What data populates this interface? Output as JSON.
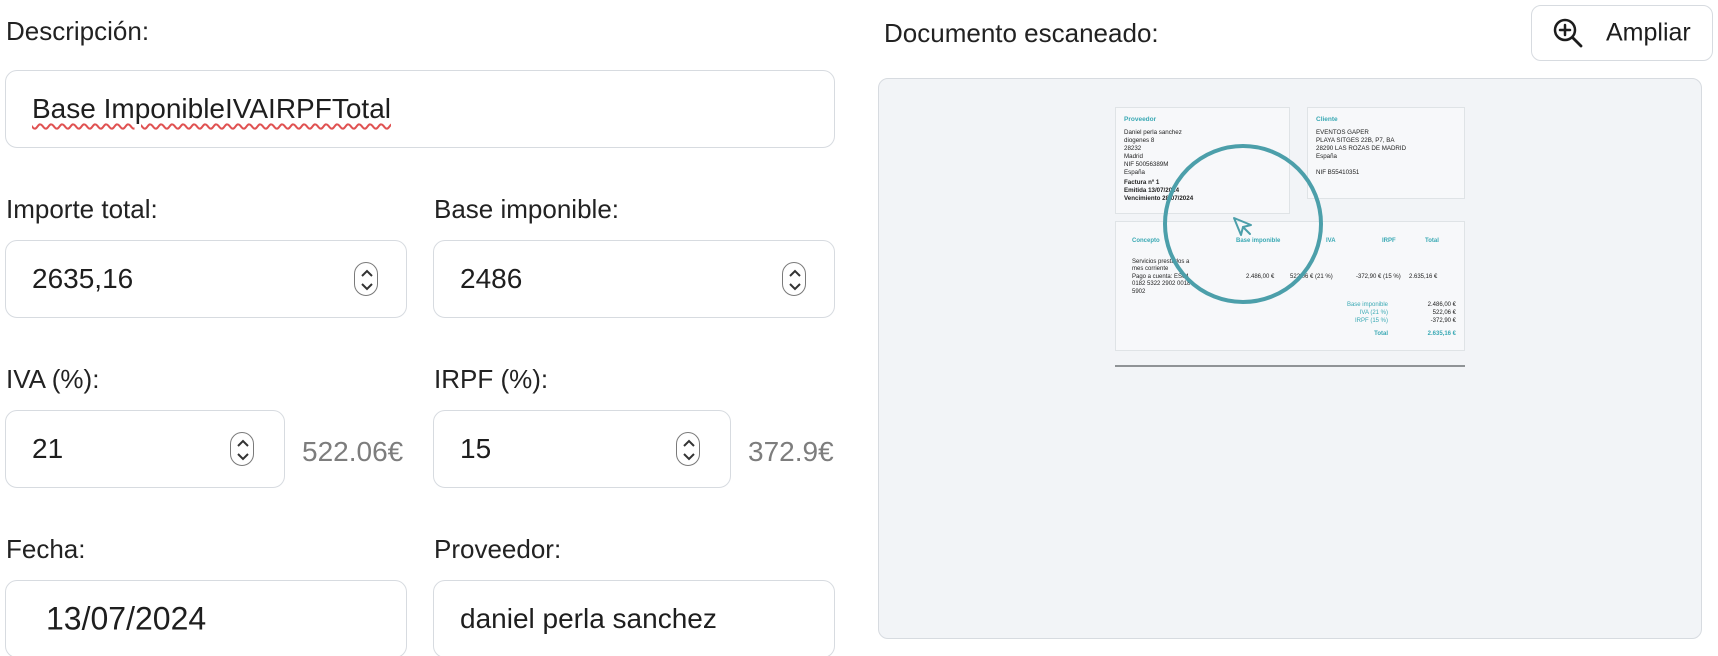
{
  "form": {
    "descripcion": {
      "label": "Descripción:",
      "value": "Base ImponibleIVAIRPFTotal"
    },
    "importe_total": {
      "label": "Importe total:",
      "value": "2635,16"
    },
    "base_imponible": {
      "label": "Base imponible:",
      "value": "2486"
    },
    "iva": {
      "label": "IVA (%):",
      "value": "21",
      "amount": "522.06€"
    },
    "irpf": {
      "label": "IRPF (%):",
      "value": "15",
      "amount": "372.9€"
    },
    "fecha": {
      "label": "Fecha:",
      "value": "13/07/2024"
    },
    "proveedor": {
      "label": "Proveedor:",
      "value": "daniel perla sanchez"
    }
  },
  "scan": {
    "title": "Documento escaneado:",
    "zoom_button": "Ampliar",
    "zoom_icon": "zoom-in-icon",
    "document": {
      "proveedor_heading": "Proveedor",
      "proveedor_lines": [
        "Daniel perla sanchez",
        "diogenes 8",
        "28232",
        "Madrid",
        "NIF 50056389M",
        "España"
      ],
      "factura_lines": [
        "Factura nº 1",
        "Emitida 13/07/2024",
        "Vencimiento 28/07/2024"
      ],
      "cliente_heading": "Cliente",
      "cliente_lines": [
        "EVENTOS GAPER",
        "PLAYA SITGES 22B, P7, BA",
        "28290 LAS ROZAS DE MADRID",
        "España",
        "",
        "NIF B55410351"
      ],
      "table_headers": [
        "Concepto",
        "Base imponible",
        "IVA",
        "IRPF",
        "Total"
      ],
      "row_concept": [
        "Servicios prestados a",
        "mes corriente",
        "Pago a cuenta: ES04",
        "0182 5322 2902 0018",
        "5902"
      ],
      "row_values": [
        "2.486,00 €",
        "522,06 € (21 %)",
        "-372,90 € (15 %)",
        "2.635,16 €"
      ],
      "summary": [
        {
          "label": "Base imponible",
          "value": "2.486,00 €"
        },
        {
          "label": "IVA (21 %)",
          "value": "522,06 €"
        },
        {
          "label": "IRPF (15 %)",
          "value": "-372,90 €"
        },
        {
          "label": "Total",
          "value": "2.635,16 €"
        }
      ]
    }
  },
  "colors": {
    "accent": "#3aa9b4",
    "border": "#d7dbe0",
    "muted": "#7d7d7d",
    "preview_bg": "#f2f4f7"
  }
}
